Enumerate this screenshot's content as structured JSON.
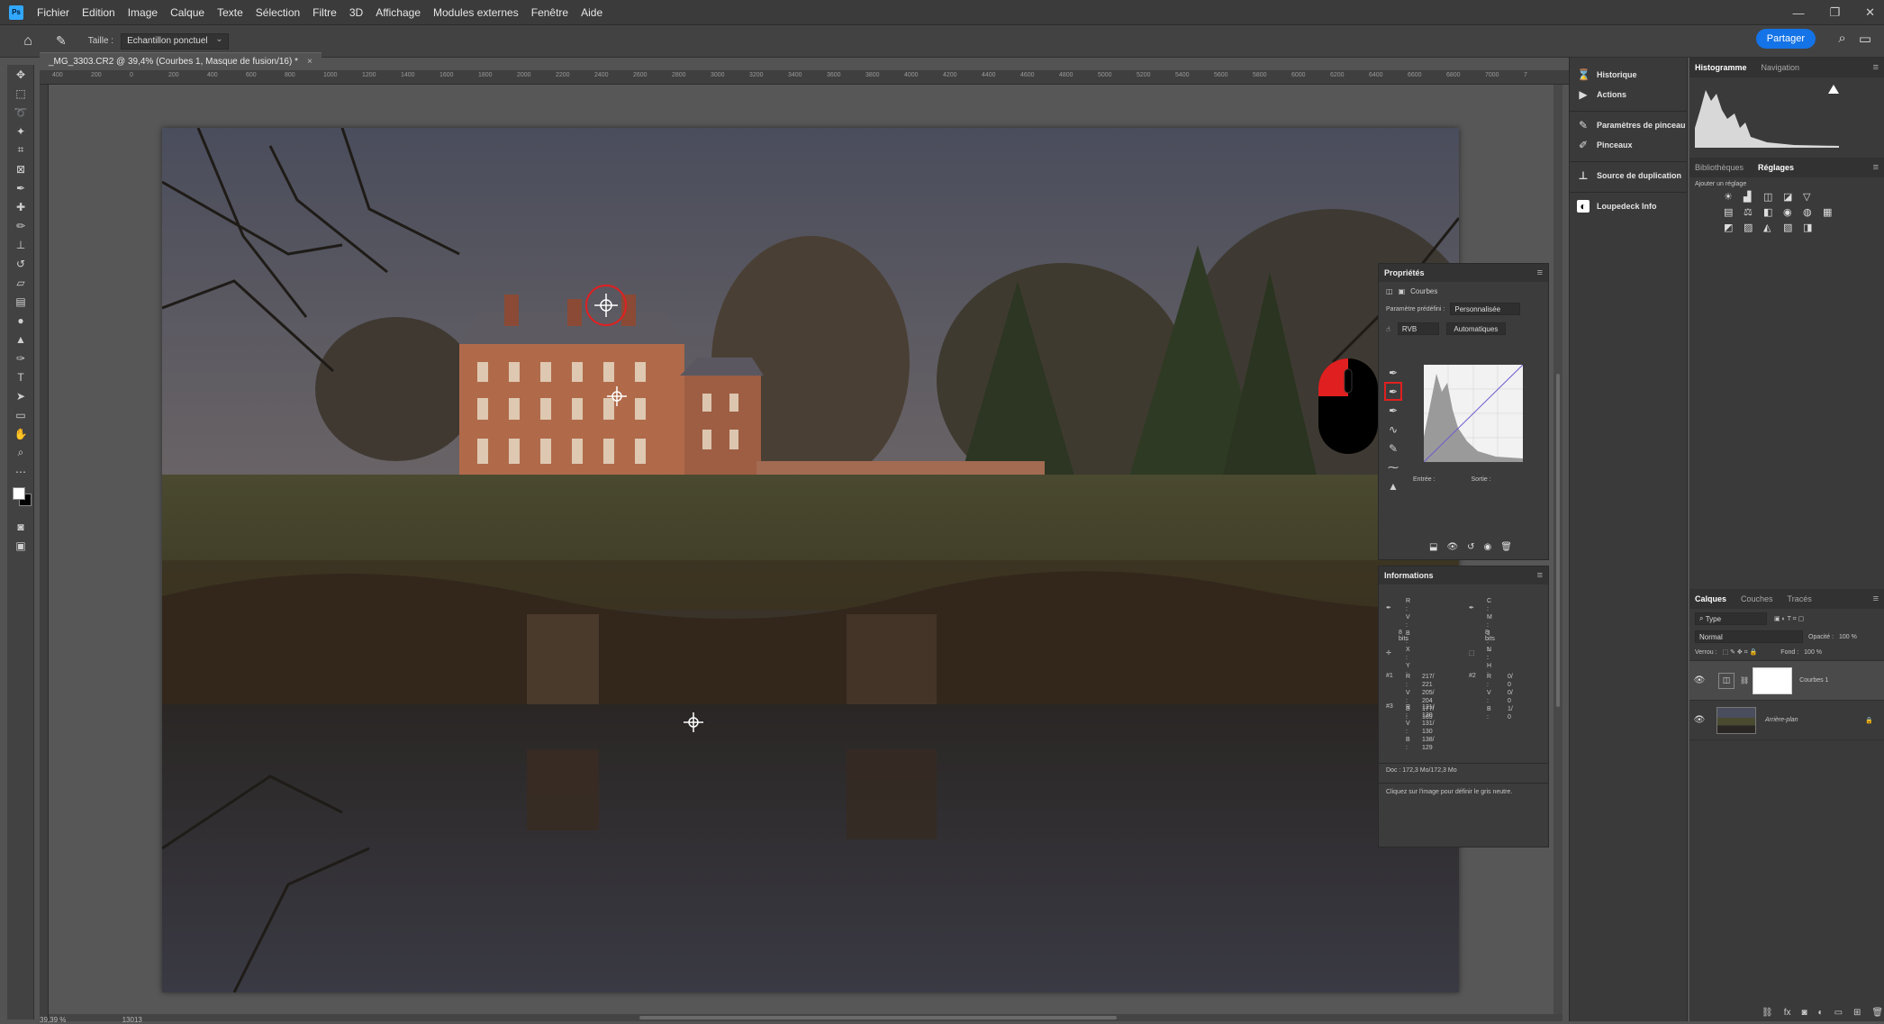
{
  "app": {
    "logo": "Ps"
  },
  "menu": [
    "Fichier",
    "Edition",
    "Image",
    "Calque",
    "Texte",
    "Sélection",
    "Filtre",
    "3D",
    "Affichage",
    "Modules externes",
    "Fenêtre",
    "Aide"
  ],
  "window_controls": {
    "minimize": "—",
    "restore": "❐",
    "close": "✕"
  },
  "options_bar": {
    "size_label": "Taille :",
    "sample_value": "Echantillon ponctuel",
    "share_label": "Partager"
  },
  "document": {
    "tab_title": "_MG_3303.CR2 @ 39,4% (Courbes 1, Masque de fusion/16) *",
    "close": "×",
    "zoom": "39,39 %",
    "status_extra": "13013"
  },
  "ruler_ticks": [
    "400",
    "200",
    "0",
    "200",
    "400",
    "600",
    "800",
    "1000",
    "1200",
    "1400",
    "1600",
    "1800",
    "2000",
    "2200",
    "2400",
    "2600",
    "2800",
    "3000",
    "3200",
    "3400",
    "3600",
    "3800",
    "4000",
    "4200",
    "4400",
    "4600",
    "4800",
    "5000",
    "5200",
    "5400",
    "5600",
    "5800",
    "6000",
    "6200",
    "6400",
    "6600",
    "6800",
    "7000",
    "7"
  ],
  "dock_mid": [
    {
      "icon": "history-icon",
      "label": "Historique"
    },
    {
      "icon": "play-icon",
      "label": "Actions"
    },
    {
      "icon": "brush-settings-icon",
      "label": "Paramètres de pinceau"
    },
    {
      "icon": "brushes-icon",
      "label": "Pinceaux"
    },
    {
      "icon": "clone-source-icon",
      "label": "Source de duplication"
    },
    {
      "icon": "loupedeck-icon",
      "label": "Loupedeck Info"
    }
  ],
  "histogram_tabs": {
    "tab1": "Histogramme",
    "tab2": "Navigation"
  },
  "adjust_tabs": {
    "tab1": "Bibliothèques",
    "tab2": "Réglages",
    "add_label": "Ajouter un réglage"
  },
  "properties": {
    "title": "Propriétés",
    "type": "Courbes",
    "preset_label": "Paramètre prédéfini :",
    "preset_value": "Personnalisée",
    "channel": "RVB",
    "auto_button": "Automatiques",
    "input_label": "Entrée :",
    "output_label": "Sortie :"
  },
  "info": {
    "title": "Informations",
    "rgb_labels": [
      "R :",
      "V :",
      "B :"
    ],
    "cmyk_labels": [
      "C :",
      "M :",
      "J :",
      "N :"
    ],
    "bits_left": "8 bits",
    "bits_right": "8 bits",
    "xy_labels": [
      "X :",
      "Y :"
    ],
    "wh_labels": [
      "L :",
      "H :"
    ],
    "s1": {
      "tag": "#1",
      "R": "217/  221",
      "V": "205/  204",
      "B": "177/  169"
    },
    "s2": {
      "tag": "#2",
      "R": "0/   0",
      "V": "0/   0",
      "B": "1/   0"
    },
    "s3": {
      "tag": "#3",
      "R": "121/  130",
      "V": "131/  130",
      "B": "138/  129"
    },
    "doc": "Doc : 172,3 Mo/172,3 Mo",
    "hint": "Cliquez sur l'image pour définir le gris neutre."
  },
  "layers": {
    "tabs": [
      "Calques",
      "Couches",
      "Tracés"
    ],
    "filter": "Type",
    "blend": "Normal",
    "opacity_label": "Opacité :",
    "opacity_value": "100 %",
    "lock_label": "Verrou :",
    "fill_label": "Fond :",
    "fill_value": "100 %",
    "items": [
      {
        "name": "Courbes 1",
        "selected": true
      },
      {
        "name": "Arrière-plan",
        "selected": false
      }
    ]
  },
  "colors": {
    "accent": "#1473e6",
    "highlight": "#e02020",
    "panel": "#3c3c3c"
  }
}
